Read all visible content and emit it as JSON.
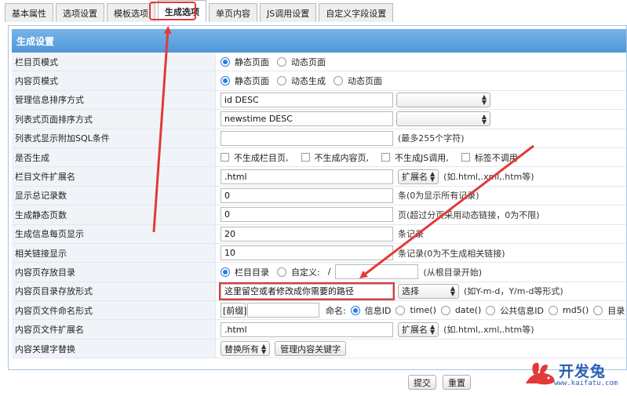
{
  "tabs": [
    {
      "label": "基本属性"
    },
    {
      "label": "选项设置"
    },
    {
      "label": "模板选项"
    },
    {
      "label": "生成选项"
    },
    {
      "label": "单页内容"
    },
    {
      "label": "JS调用设置"
    },
    {
      "label": "自定义字段设置"
    }
  ],
  "panel": {
    "title": "生成设置"
  },
  "rows": {
    "list_mode": {
      "label": "栏目页模式",
      "opt1": "静态页面",
      "opt2": "动态页面"
    },
    "content_mode": {
      "label": "内容页模式",
      "opt1": "静态页面",
      "opt2": "动态生成",
      "opt3": "动态页面"
    },
    "admin_order": {
      "label": "管理信息排序方式",
      "value": "id DESC"
    },
    "list_order": {
      "label": "列表式页面排序方式",
      "value": "newstime DESC"
    },
    "sql_where": {
      "label": "列表式显示附加SQL条件",
      "value": "",
      "hint": "(最多255个字符)"
    },
    "generate": {
      "label": "是否生成",
      "c1": "不生成栏目页,",
      "c2": "不生成内容页,",
      "c3": "不生成JS调用,",
      "c4": "标签不调用"
    },
    "list_ext": {
      "label": "栏目文件扩展名",
      "value": ".html",
      "button": "扩展名",
      "hint": "(如.html,.xml,.htm等)"
    },
    "total_count": {
      "label": "显示总记录数",
      "value": "0",
      "hint": "条(0为显示所有记录)"
    },
    "static_pages": {
      "label": "生成静态页数",
      "value": "0",
      "hint": "页(超过分页采用动态链接，0为不限)"
    },
    "per_page": {
      "label": "生成信息每页显示",
      "value": "20",
      "hint": "条记录"
    },
    "related": {
      "label": "相关链接显示",
      "value": "10",
      "hint": "条记录(0为不生成相关链接)"
    },
    "content_dir": {
      "label": "内容页存放目录",
      "opt1": "栏目目录",
      "opt2": "自定义:",
      "slash": "/",
      "value": "",
      "hint": "(从根目录开始)"
    },
    "content_path": {
      "label": "内容页目录存放形式",
      "value": "这里留空或者修改成你需要的路径",
      "select": "选择",
      "hint": "(如Y-m-d，Y/m-d等形式)"
    },
    "content_naming": {
      "label": "内容页文件命名形式",
      "prefix": "[前缀]",
      "name_label": "命名:",
      "o1": "信息ID",
      "o2": "time()",
      "o3": "date()",
      "o4": "公共信息ID",
      "o5": "md5()",
      "o6": "目录"
    },
    "content_ext": {
      "label": "内容页文件扩展名",
      "value": ".html",
      "button": "扩展名",
      "hint": "(如.html,.xml,.htm等)"
    },
    "keyword": {
      "label": "内容关键字替换",
      "select": "替换所有",
      "button": "管理内容关键字"
    }
  },
  "actions": {
    "submit": "提交",
    "reset": "重置"
  },
  "watermark": {
    "brand": "开发兔",
    "url": "www.kaifatu.com"
  },
  "colors": {
    "accent": "#e23a3a",
    "header": "#5aa2e0",
    "radio": "#2b7de0"
  }
}
